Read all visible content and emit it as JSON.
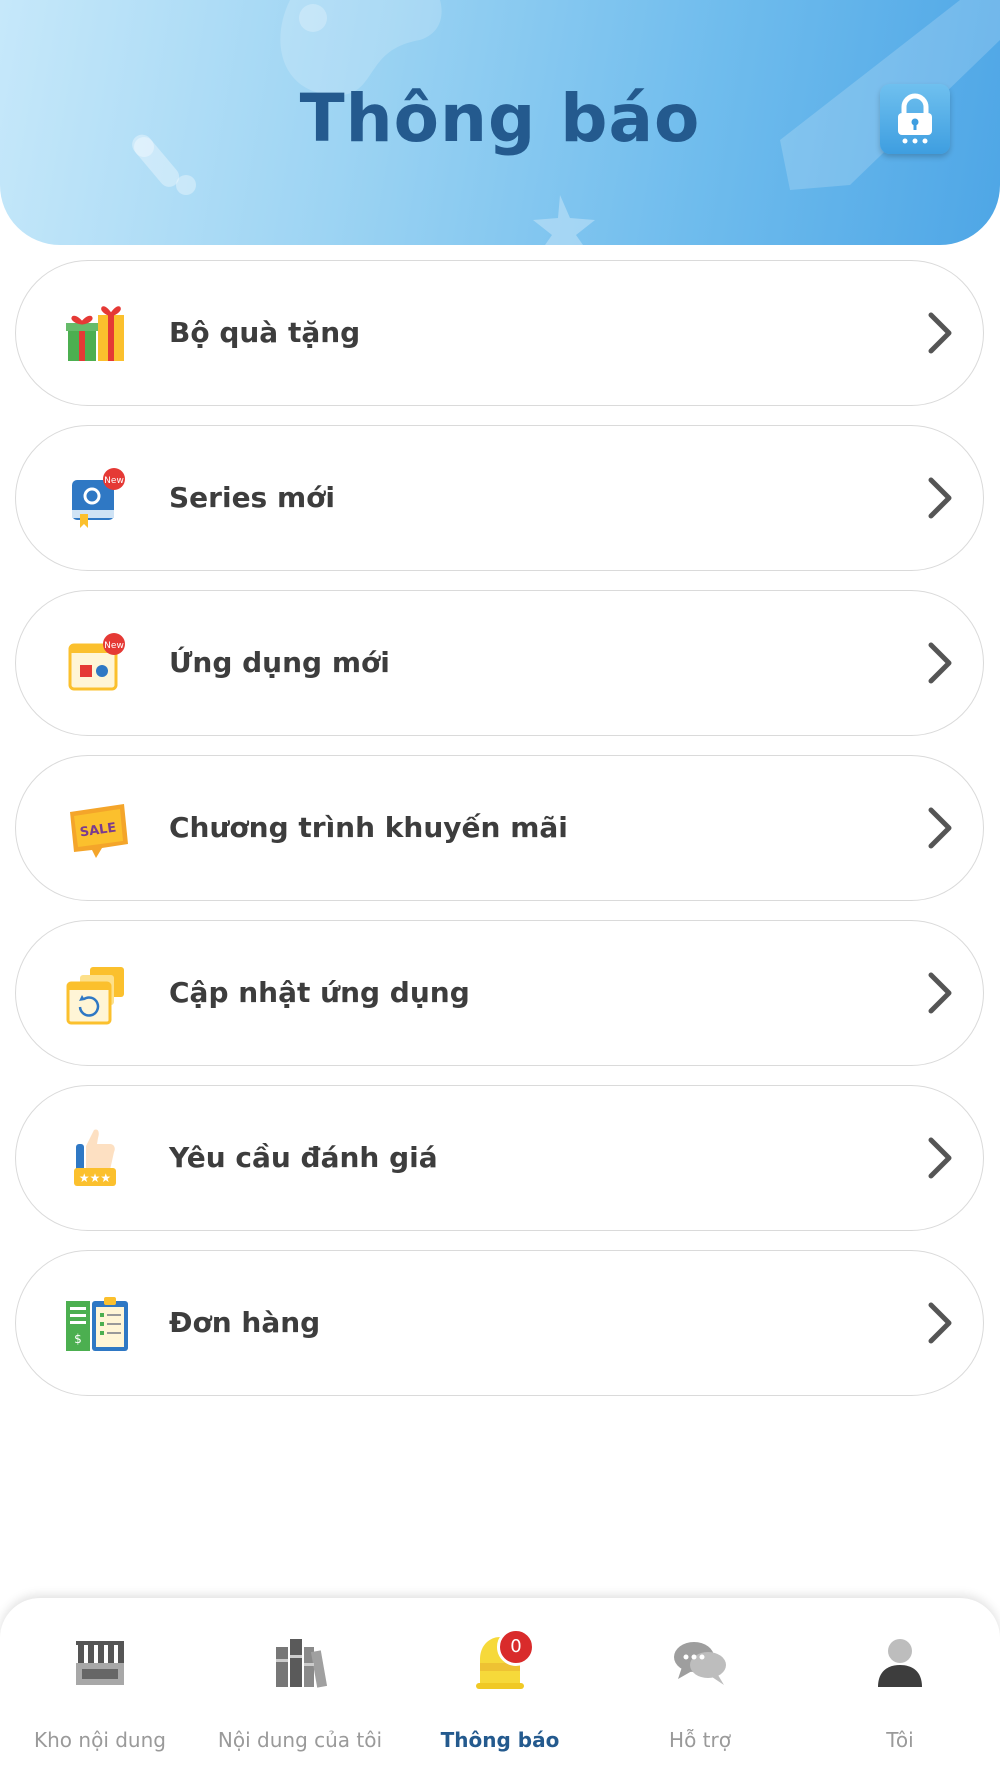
{
  "header": {
    "title": "Thông báo",
    "lock_icon": "lock-icon"
  },
  "items": [
    {
      "label": "Bộ quà tặng",
      "icon": "gift-icon"
    },
    {
      "label": "Series mới",
      "icon": "book-new-icon"
    },
    {
      "label": "Ứng dụng mới",
      "icon": "app-new-icon"
    },
    {
      "label": "Chương trình khuyến mãi",
      "icon": "sale-tag-icon"
    },
    {
      "label": "Cập nhật ứng dụng",
      "icon": "app-update-icon"
    },
    {
      "label": "Yêu cầu đánh giá",
      "icon": "thumbs-up-rating-icon"
    },
    {
      "label": "Đơn hàng",
      "icon": "orders-clipboard-icon"
    }
  ],
  "nav": {
    "tabs": [
      {
        "label": "Kho nội dung",
        "icon": "store-icon"
      },
      {
        "label": "Nội dung của tôi",
        "icon": "books-icon"
      },
      {
        "label": "Thông báo",
        "icon": "bell-icon",
        "badge": "0",
        "active": true
      },
      {
        "label": "Hỗ trợ",
        "icon": "chat-icon"
      },
      {
        "label": "Tôi",
        "icon": "user-icon"
      }
    ]
  },
  "colors": {
    "title": "#245a8e",
    "active_tab": "#245a8e",
    "badge": "#d92b2b"
  }
}
